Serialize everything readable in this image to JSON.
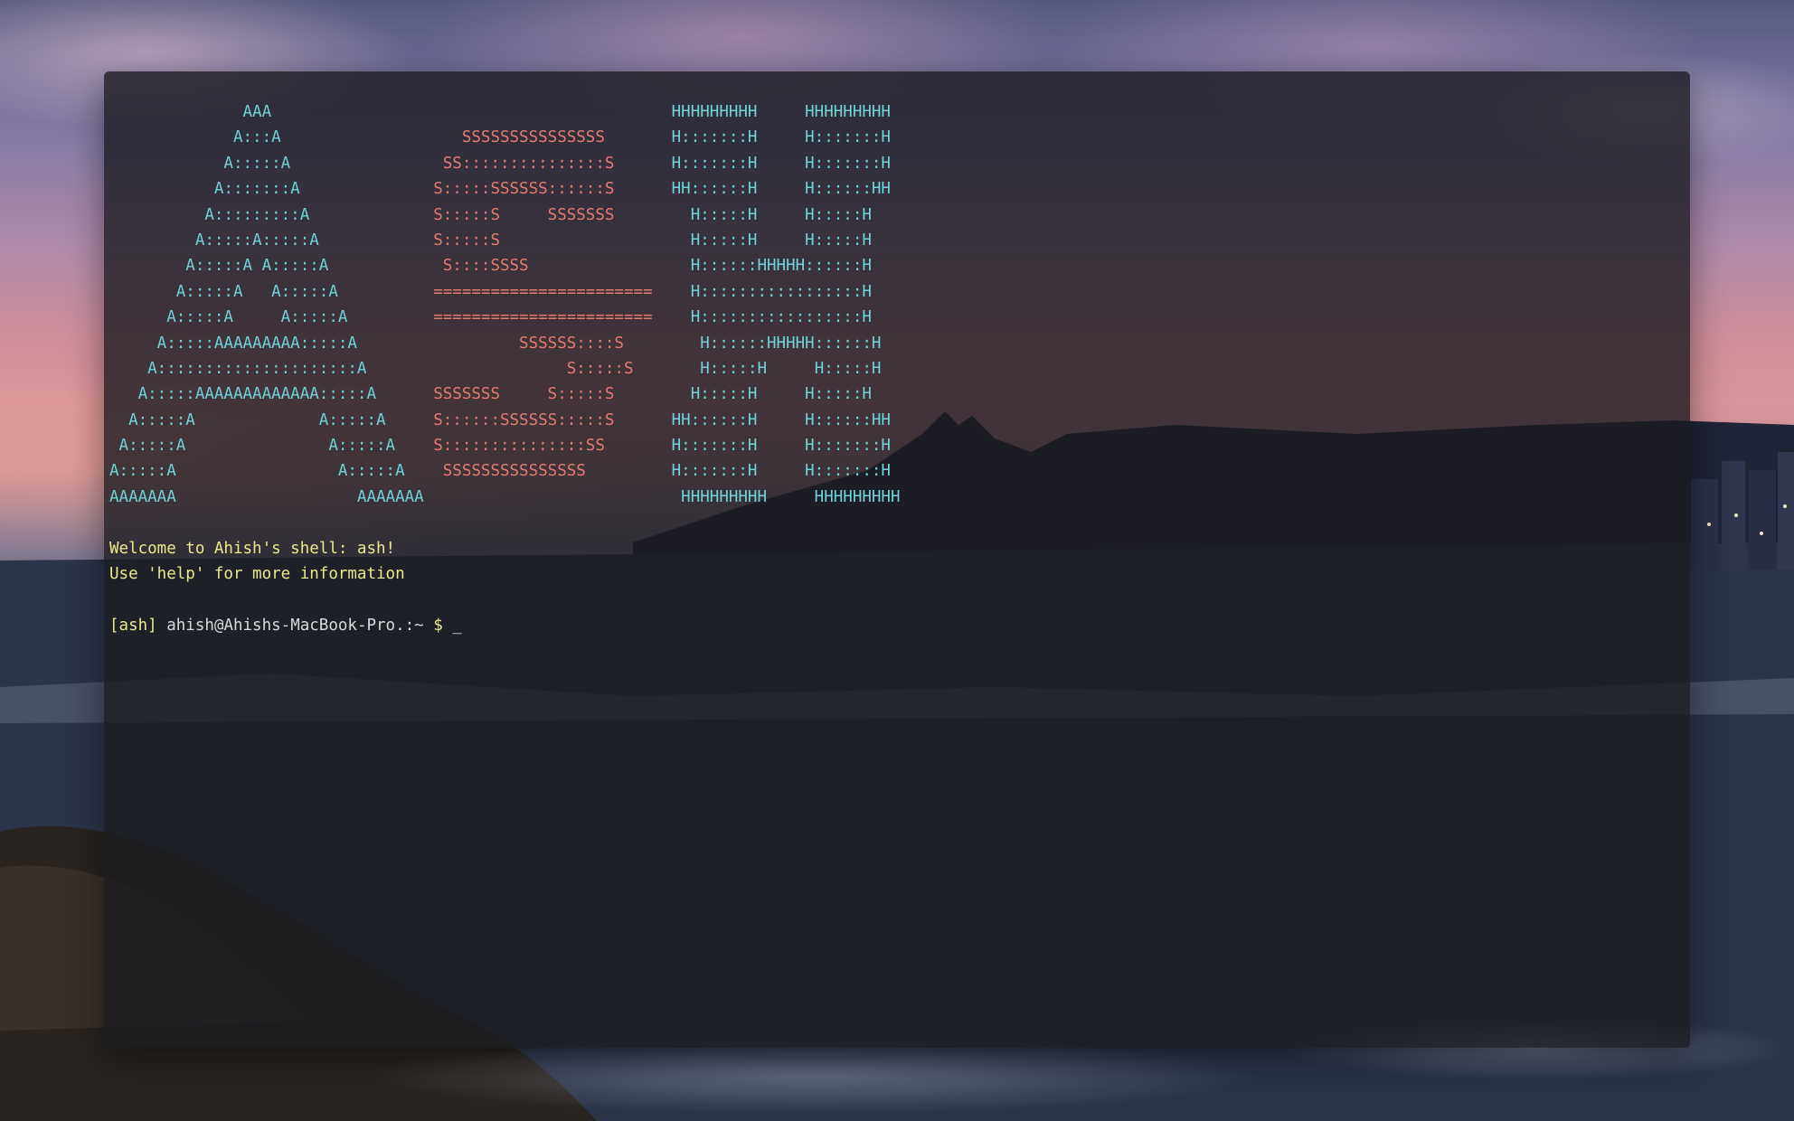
{
  "terminal": {
    "banner": [
      {
        "a": "              AAA              ",
        "s": "                       ",
        "h": "HHHHHHHHH     HHHHHHHHH"
      },
      {
        "a": "             A:::A             ",
        "s": "   SSSSSSSSSSSSSSS     ",
        "h": "H:::::::H     H:::::::H"
      },
      {
        "a": "            A:::::A            ",
        "s": " SS:::::::::::::::S    ",
        "h": "H:::::::H     H:::::::H"
      },
      {
        "a": "           A:::::::A           ",
        "s": "S:::::SSSSSS::::::S    ",
        "h": "HH::::::H     H::::::HH"
      },
      {
        "a": "          A:::::::::A          ",
        "s": "S:::::S     SSSSSSS    ",
        "h": "  H:::::H     H:::::H  "
      },
      {
        "a": "         A:::::A:::::A         ",
        "s": "S:::::S                ",
        "h": "  H:::::H     H:::::H  "
      },
      {
        "a": "        A:::::A A:::::A        ",
        "s": " S::::SSSS             ",
        "h": "  H::::::HHHHH::::::H  "
      },
      {
        "a": "       A:::::A   A:::::A       ",
        "s": "======================= ",
        "h": " H:::::::::::::::::H  "
      },
      {
        "a": "      A:::::A     A:::::A      ",
        "s": "======================= ",
        "h": " H:::::::::::::::::H  "
      },
      {
        "a": "     A:::::AAAAAAAAA:::::A     ",
        "s": "         SSSSSS::::S    ",
        "h": "  H::::::HHHHH::::::H  "
      },
      {
        "a": "    A:::::::::::::::::::::A    ",
        "s": "              S:::::S   ",
        "h": "  H:::::H     H:::::H  "
      },
      {
        "a": "   A:::::AAAAAAAAAAAAA:::::A   ",
        "s": "SSSSSSS     S:::::S    ",
        "h": "  H:::::H     H:::::H  "
      },
      {
        "a": "  A:::::A             A:::::A  ",
        "s": "S::::::SSSSSS:::::S    ",
        "h": "HH::::::H     H::::::HH"
      },
      {
        "a": " A:::::A               A:::::A ",
        "s": "S:::::::::::::::SS     ",
        "h": "H:::::::H     H:::::::H"
      },
      {
        "a": "A:::::A                 A:::::A",
        "s": " SSSSSSSSSSSSSSS       ",
        "h": "H:::::::H     H:::::::H"
      },
      {
        "a": "AAAAAAA                   AAAAAAA",
        "s": "                      ",
        "h": "HHHHHHHHH     HHHHHHHHH"
      }
    ],
    "welcome_line_1": "Welcome to Ahish's shell: ash!",
    "welcome_line_2": "Use 'help' for more information",
    "prompt": {
      "tag": "[ash]",
      "user_host": "ahish@Ahishs-MacBook-Pro.",
      "path": ":~",
      "symbol": "$",
      "cursor": "_"
    }
  },
  "colors": {
    "banner_a": "#6fd3d8",
    "banner_s": "#e67b72",
    "banner_h": "#6fd3d8",
    "welcome": "#ece98c",
    "prompt_text": "#d9d9d9"
  }
}
